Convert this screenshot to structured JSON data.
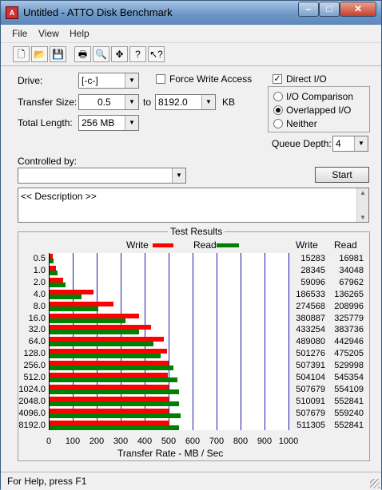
{
  "window": {
    "title": "Untitled - ATTO Disk Benchmark",
    "min": "–",
    "max": "□",
    "close": "✕"
  },
  "menu": [
    "File",
    "View",
    "Help"
  ],
  "toolbar": [
    "new-icon",
    "open-icon",
    "save-icon",
    "print-icon",
    "print-preview-icon",
    "move-icon",
    "help-icon",
    "context-help-icon"
  ],
  "form": {
    "drive_label": "Drive:",
    "drive_value": "[-c-]",
    "transfer_label": "Transfer Size:",
    "transfer_from": "0.5",
    "to_label": "to",
    "transfer_to": "8192.0",
    "unit": "KB",
    "length_label": "Total Length:",
    "length_value": "256 MB",
    "force_write_label": "Force Write Access",
    "force_write_checked": false,
    "direct_io_label": "Direct I/O",
    "direct_io_checked": true,
    "radio_io_comparison": "I/O Comparison",
    "radio_overlapped": "Overlapped I/O",
    "radio_neither": "Neither",
    "selected_mode": "Overlapped I/O",
    "queue_depth_label": "Queue Depth:",
    "queue_depth_value": "4",
    "controlled_by_label": "Controlled by:",
    "controlled_by_value": "",
    "start_label": "Start",
    "description": "<< Description >>"
  },
  "results": {
    "title": "Test Results",
    "legend_write": "Write",
    "legend_read": "Read",
    "col_write": "Write",
    "col_read": "Read",
    "write_color": "#ff0000",
    "read_color": "#008000"
  },
  "chart_data": {
    "type": "bar",
    "orientation": "horizontal",
    "categories": [
      "0.5",
      "1.0",
      "2.0",
      "4.0",
      "8.0",
      "16.0",
      "32.0",
      "64.0",
      "128.0",
      "256.0",
      "512.0",
      "1024.0",
      "2048.0",
      "4096.0",
      "8192.0"
    ],
    "series": [
      {
        "name": "Write",
        "values": [
          15283,
          28345,
          59096,
          186533,
          274568,
          380887,
          433254,
          489080,
          501276,
          507391,
          504104,
          507679,
          510091,
          507679,
          511305
        ]
      },
      {
        "name": "Read",
        "values": [
          16981,
          34048,
          67962,
          136265,
          208996,
          325779,
          383736,
          442946,
          475205,
          529998,
          545354,
          554109,
          552841,
          559240,
          552841
        ]
      }
    ],
    "xlabel": "Transfer Rate - MB / Sec",
    "xlim": [
      0,
      1000
    ],
    "xticks": [
      "0",
      "100",
      "200",
      "300",
      "400",
      "500",
      "600",
      "700",
      "800",
      "900",
      "1000"
    ],
    "grid": true,
    "legend": "top"
  },
  "status": "For Help, press F1"
}
